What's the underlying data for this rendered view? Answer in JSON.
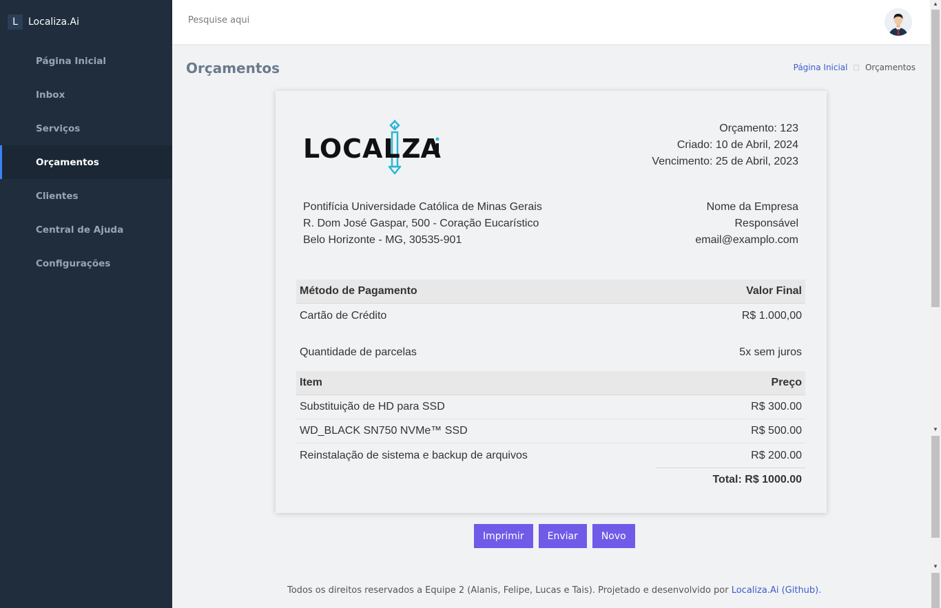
{
  "sidebar": {
    "brand_letter": "L",
    "brand_name": "Localiza.Ai",
    "items": [
      {
        "label": "Página Inicial"
      },
      {
        "label": "Inbox"
      },
      {
        "label": "Serviços"
      },
      {
        "label": "Orçamentos",
        "active": true
      },
      {
        "label": "Clientes"
      },
      {
        "label": "Central de Ajuda"
      },
      {
        "label": "Configurações"
      }
    ]
  },
  "header": {
    "search_placeholder": "Pesquise aqui",
    "avatar_icon": "user-avatar-icon"
  },
  "page": {
    "title": "Orçamentos",
    "breadcrumb": {
      "home": "Página Inicial",
      "current": "Orçamentos"
    }
  },
  "invoice": {
    "logo_text": "LOCALIZAi",
    "numero": "Orçamento: 123",
    "criado": "Criado: 10 de Abril, 2024",
    "vencimento": "Vencimento: 25 de Abril, 2023",
    "from": {
      "line1": "Pontifícia Universidade Católica de Minas Gerais",
      "line2": "R. Dom José Gaspar, 500 - Coração Eucarístico",
      "line3": "Belo Horizonte - MG, 30535-901"
    },
    "to": {
      "line1": "Nome da Empresa",
      "line2": "Responsável",
      "line3": "email@examplo.com"
    },
    "payment": {
      "col1": "Método de Pagamento",
      "col2": "Valor Final",
      "method": "Cartão de Crédito",
      "value": "R$ 1.000,00",
      "installments_label": "Quantidade de parcelas",
      "installments_value": "5x sem juros"
    },
    "items": {
      "col1": "Item",
      "col2": "Preço",
      "rows": [
        {
          "name": "Substituição de HD para SSD",
          "price": "R$ 300.00"
        },
        {
          "name": "WD_BLACK SN750 NVMe™ SSD",
          "price": "R$ 500.00"
        },
        {
          "name": "Reinstalação de sistema e backup de arquivos",
          "price": "R$ 200.00"
        }
      ],
      "total": "Total: R$ 1000.00"
    }
  },
  "actions": {
    "print": "Imprimir",
    "send": "Enviar",
    "new": "Novo"
  },
  "footer": {
    "text": "Todos os direitos reservados a Equipe 2 (Alanis, Felipe, Lucas e Tais). Projetado e desenvolvido por ",
    "link": "Localiza.Ai (Github)."
  },
  "colors": {
    "sidebar_bg": "#1f2d3d",
    "accent": "#6f5be8",
    "link": "#3b5ccc",
    "logo_cyan": "#2ab7d6"
  }
}
